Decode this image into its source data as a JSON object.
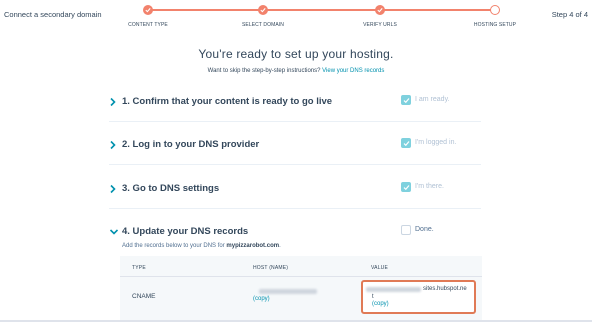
{
  "header": {
    "app_title": "Connect a secondary domain",
    "step_indicator": "Step 4 of 4",
    "steps": [
      {
        "label": "CONTENT TYPE",
        "state": "done"
      },
      {
        "label": "SELECT DOMAIN",
        "state": "done"
      },
      {
        "label": "VERIFY URLS",
        "state": "done"
      },
      {
        "label": "HOSTING SETUP",
        "state": "current"
      }
    ]
  },
  "main": {
    "heading": "You're ready to set up your hosting.",
    "skip_prefix": "Want to skip the step-by-step instructions?",
    "skip_link": "View your DNS records"
  },
  "sections": [
    {
      "title": "1. Confirm that your content is ready to go live",
      "checkbox_label": "I am ready.",
      "checked": true,
      "expanded": false
    },
    {
      "title": "2. Log in to your DNS provider",
      "checkbox_label": "I'm logged in.",
      "checked": true,
      "expanded": false
    },
    {
      "title": "3. Go to DNS settings",
      "checkbox_label": "I'm there.",
      "checked": true,
      "expanded": false
    },
    {
      "title": "4. Update your DNS records",
      "checkbox_label": "Done.",
      "checked": false,
      "expanded": true
    }
  ],
  "records": {
    "note_prefix": "Add the records below to your DNS for",
    "domain": "mypizzarobot.com",
    "columns": [
      "TYPE",
      "HOST (NAME)",
      "VALUE"
    ],
    "rows": [
      {
        "type": "CNAME",
        "host_copy": "(copy)",
        "value_visible": "sites.hubspot.ne",
        "value_tail": "t",
        "value_copy": "(copy)"
      }
    ]
  },
  "colors": {
    "accent": "#f2826c",
    "checkbox_checked": "#7fd1de",
    "link": "#0091ae",
    "highlight_border": "#e07a56"
  },
  "icons": {
    "step_done": "check-icon",
    "section_toggle": "chevron-icon",
    "checkbox": "checkmark-icon"
  }
}
